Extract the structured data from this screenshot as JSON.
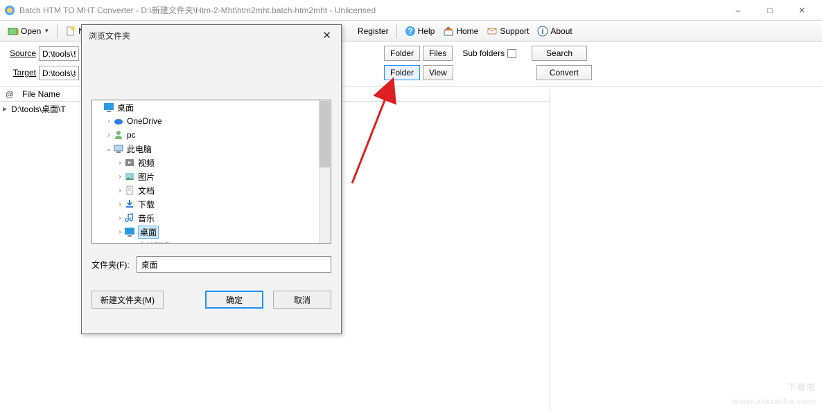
{
  "titlebar": {
    "title": "Batch HTM TO MHT Converter - D:\\新建文件夹\\Htm-2-Mht\\htm2mht.batch-htm2mht - Unlicensed"
  },
  "toolbar": {
    "open": "Open",
    "new_prefix": "N",
    "register": "Register",
    "help": "Help",
    "home": "Home",
    "support": "Support",
    "about": "About"
  },
  "paths": {
    "source_label": "Source",
    "target_label": "Target",
    "source_value": "D:\\tools\\桌面",
    "target_value": "D:\\tools\\桌面",
    "folder_btn": "Folder",
    "files_btn": "Files",
    "view_btn": "View",
    "subfolders_label": "Sub folders",
    "search_btn": "Search",
    "convert_btn": "Convert"
  },
  "filelist": {
    "at": "@",
    "header": "File Name",
    "rows": [
      "D:\\tools\\桌面\\T"
    ]
  },
  "dialog": {
    "title": "浏览文件夹",
    "tree": {
      "root": "桌面",
      "onedrive": "OneDrive",
      "pc_user": "pc",
      "this_pc": "此电脑",
      "videos": "视频",
      "pictures": "图片",
      "documents": "文档",
      "downloads": "下载",
      "music": "音乐",
      "desktop_sel": "桌面",
      "local_disk": "本地磁盘 (C:)"
    },
    "folder_label": "文件夹(F):",
    "folder_value": "桌面",
    "new_folder_btn": "新建文件夹(M)",
    "ok_btn": "确定",
    "cancel_btn": "取消"
  },
  "watermark": {
    "main": "下载吧",
    "sub": "www.xiazaiba.com"
  }
}
